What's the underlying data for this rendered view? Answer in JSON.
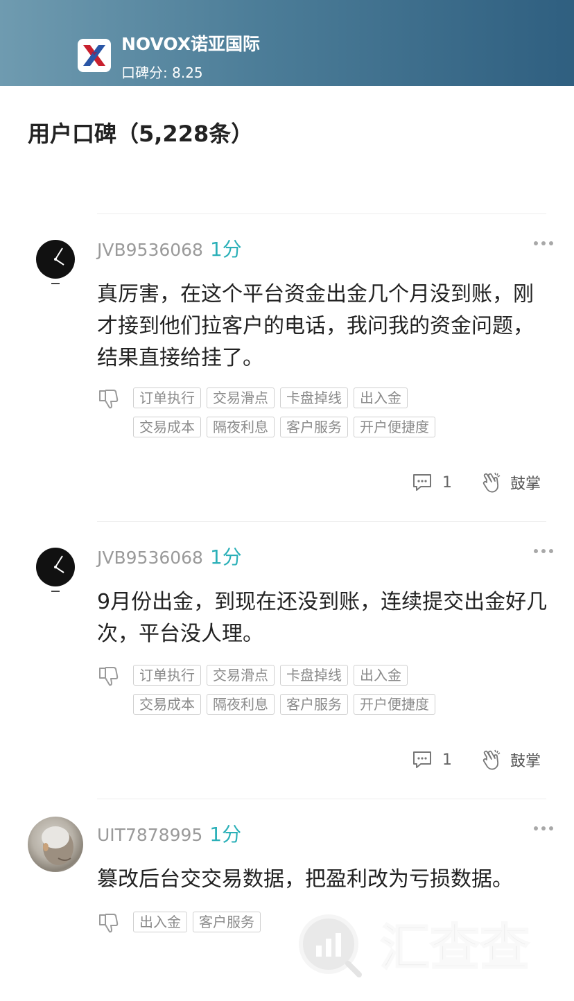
{
  "header": {
    "broker_name": "NOVOX诺亚国际",
    "score_label": "口碑分:",
    "score_value": "8.25",
    "logo_icon": "novox-x-logo"
  },
  "section": {
    "title": "用户口碑（5,228条）"
  },
  "reviews": [
    {
      "username": "JVB9536068",
      "rating": "1分",
      "avatar": "watch-avatar",
      "content": "真厉害，在这个平台资金出金几个月没到账，刚才接到他们拉客户的电话，我问我的资金问题，结果直接给挂了。",
      "tags": [
        "订单执行",
        "交易滑点",
        "卡盘掉线",
        "出入金",
        "交易成本",
        "隔夜利息",
        "客户服务",
        "开户便捷度"
      ],
      "comment_count": "1",
      "clap_label": "鼓掌"
    },
    {
      "username": "JVB9536068",
      "rating": "1分",
      "avatar": "watch-avatar",
      "content": "9月份出金，到现在还没到账，连续提交出金好几次，平台没人理。",
      "tags": [
        "订单执行",
        "交易滑点",
        "卡盘掉线",
        "出入金",
        "交易成本",
        "隔夜利息",
        "客户服务",
        "开户便捷度"
      ],
      "comment_count": "1",
      "clap_label": "鼓掌"
    },
    {
      "username": "UIT7878995",
      "rating": "1分",
      "avatar": "photo-avatar",
      "content": "篡改后台交交易数据，把盈利改为亏损数据。",
      "tags": [
        "出入金",
        "客户服务"
      ]
    }
  ],
  "watermark": {
    "text": "汇查查"
  },
  "colors": {
    "accent": "#2bb0b8",
    "header_start": "#6f9bb0",
    "header_end": "#2f5f80"
  }
}
